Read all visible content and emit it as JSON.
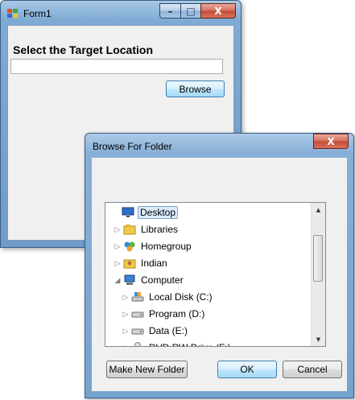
{
  "form1": {
    "title": "Form1",
    "heading": "Select the Target Location",
    "path_value": "",
    "browse_label": "Browse",
    "caption_buttons": {
      "minimize": "–",
      "maximize": "□",
      "close": "X"
    }
  },
  "browse_dialog": {
    "title": "Browse For Folder",
    "close_glyph": "X",
    "tree": [
      {
        "label": "Desktop",
        "icon": "desktop-icon",
        "indent": 0,
        "expander": "",
        "selected": true
      },
      {
        "label": "Libraries",
        "icon": "libraries-icon",
        "indent": 1,
        "expander": "▷"
      },
      {
        "label": "Homegroup",
        "icon": "homegroup-icon",
        "indent": 1,
        "expander": "▷"
      },
      {
        "label": "Indian",
        "icon": "user-folder-icon",
        "indent": 1,
        "expander": "▷"
      },
      {
        "label": "Computer",
        "icon": "computer-icon",
        "indent": 1,
        "expander": "◢"
      },
      {
        "label": "Local Disk (C:)",
        "icon": "local-disk-icon",
        "indent": 2,
        "expander": "▷"
      },
      {
        "label": "Program (D:)",
        "icon": "drive-icon",
        "indent": 2,
        "expander": "▷"
      },
      {
        "label": "Data (E:)",
        "icon": "drive-icon",
        "indent": 2,
        "expander": "▷"
      },
      {
        "label": "DVD RW Drive (F:)",
        "icon": "dvd-drive-icon",
        "indent": 2,
        "expander": "▷"
      }
    ],
    "buttons": {
      "new_folder": "Make New Folder",
      "ok": "OK",
      "cancel": "Cancel"
    }
  },
  "colors": {
    "selection_bg": "#dcebfc",
    "title_gradient": "#7eaad3",
    "close_button": "#c24a36"
  }
}
